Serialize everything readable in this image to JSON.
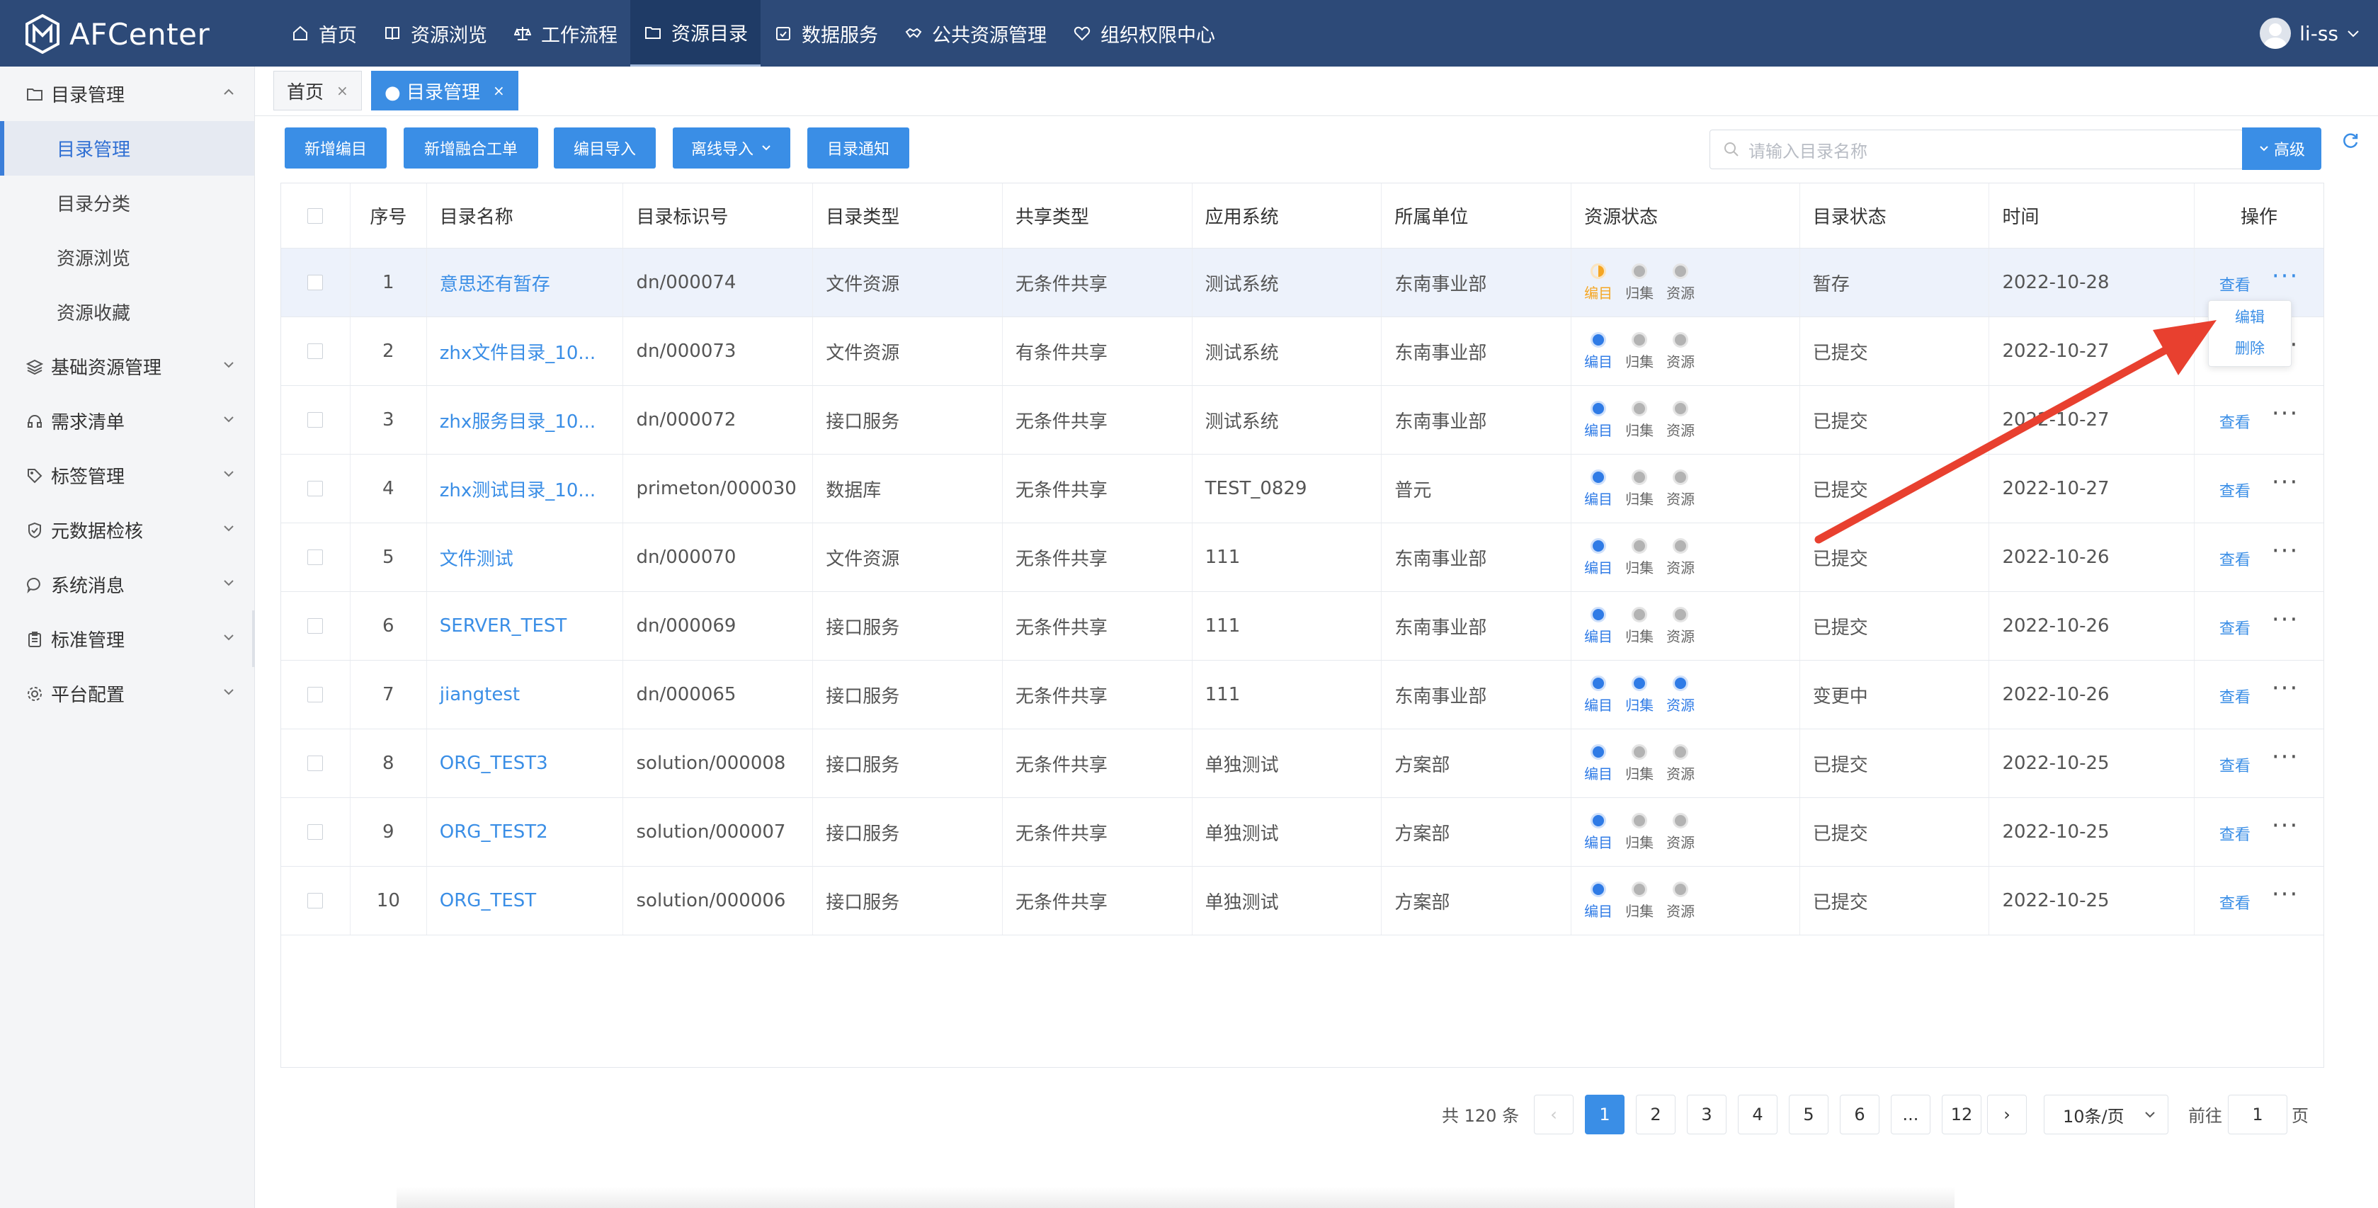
{
  "app": {
    "name": "AFCenter"
  },
  "topnav": [
    {
      "label": "首页",
      "icon": "home-icon",
      "active": false
    },
    {
      "label": "资源浏览",
      "icon": "book-icon",
      "active": false
    },
    {
      "label": "工作流程",
      "icon": "scale-icon",
      "active": false
    },
    {
      "label": "资源目录",
      "icon": "folder-icon",
      "active": true
    },
    {
      "label": "数据服务",
      "icon": "calendar-check-icon",
      "active": false
    },
    {
      "label": "公共资源管理",
      "icon": "handshake-icon",
      "active": false
    },
    {
      "label": "组织权限中心",
      "icon": "heart-shield-icon",
      "active": false
    }
  ],
  "user": {
    "name": "li-ss"
  },
  "sidebar": {
    "groups": [
      {
        "label": "目录管理",
        "icon": "folder-icon",
        "expanded": true,
        "items": [
          {
            "label": "目录管理",
            "active": true
          },
          {
            "label": "目录分类",
            "active": false
          },
          {
            "label": "资源浏览",
            "active": false
          },
          {
            "label": "资源收藏",
            "active": false
          }
        ]
      },
      {
        "label": "基础资源管理",
        "icon": "layers-icon"
      },
      {
        "label": "需求清单",
        "icon": "headset-icon"
      },
      {
        "label": "标签管理",
        "icon": "tag-icon"
      },
      {
        "label": "元数据检核",
        "icon": "shield-check-icon"
      },
      {
        "label": "系统消息",
        "icon": "chat-icon"
      },
      {
        "label": "标准管理",
        "icon": "clipboard-icon"
      },
      {
        "label": "平台配置",
        "icon": "gear-icon"
      }
    ]
  },
  "tabs": [
    {
      "label": "首页",
      "close": "×"
    },
    {
      "label": "● 目录管理",
      "close": "×"
    }
  ],
  "toolbar": {
    "buttons": [
      "新增编目",
      "新增融合工单",
      "编目导入",
      "离线导入",
      "目录通知"
    ],
    "search_placeholder": "请输入目录名称",
    "advanced": "高级"
  },
  "table": {
    "headers": [
      "",
      "序号",
      "目录名称",
      "目录标识号",
      "目录类型",
      "共享类型",
      "应用系统",
      "所属单位",
      "资源状态",
      "目录状态",
      "时间",
      "操作"
    ],
    "status_labels": [
      "编目",
      "归集",
      "资源"
    ],
    "view_label": "查看",
    "more_label": "···",
    "rows": [
      {
        "no": "1",
        "name": "意思还有暂存",
        "id": "dn/000074",
        "type": "文件资源",
        "share": "无条件共享",
        "system": "测试系统",
        "unit": "东南事业部",
        "status": [
          "half",
          "off",
          "off"
        ],
        "dir_status": "暂存",
        "time": "2022-10-28"
      },
      {
        "no": "2",
        "name": "zhx文件目录_10...",
        "id": "dn/000073",
        "type": "文件资源",
        "share": "有条件共享",
        "system": "测试系统",
        "unit": "东南事业部",
        "status": [
          "on",
          "off",
          "off"
        ],
        "dir_status": "已提交",
        "time": "2022-10-27"
      },
      {
        "no": "3",
        "name": "zhx服务目录_10...",
        "id": "dn/000072",
        "type": "接口服务",
        "share": "无条件共享",
        "system": "测试系统",
        "unit": "东南事业部",
        "status": [
          "on",
          "off",
          "off"
        ],
        "dir_status": "已提交",
        "time": "2022-10-27"
      },
      {
        "no": "4",
        "name": "zhx测试目录_10...",
        "id": "primeton/000030",
        "type": "数据库",
        "share": "无条件共享",
        "system": "TEST_0829",
        "unit": "普元",
        "status": [
          "on",
          "off",
          "off"
        ],
        "dir_status": "已提交",
        "time": "2022-10-27"
      },
      {
        "no": "5",
        "name": "文件测试",
        "id": "dn/000070",
        "type": "文件资源",
        "share": "无条件共享",
        "system": "111",
        "unit": "东南事业部",
        "status": [
          "on",
          "off",
          "off"
        ],
        "dir_status": "已提交",
        "time": "2022-10-26"
      },
      {
        "no": "6",
        "name": "SERVER_TEST",
        "id": "dn/000069",
        "type": "接口服务",
        "share": "无条件共享",
        "system": "111",
        "unit": "东南事业部",
        "status": [
          "on",
          "off",
          "off"
        ],
        "dir_status": "已提交",
        "time": "2022-10-26"
      },
      {
        "no": "7",
        "name": "jiangtest",
        "id": "dn/000065",
        "type": "接口服务",
        "share": "无条件共享",
        "system": "111",
        "unit": "东南事业部",
        "status": [
          "on",
          "on",
          "on"
        ],
        "dir_status": "变更中",
        "time": "2022-10-26"
      },
      {
        "no": "8",
        "name": "ORG_TEST3",
        "id": "solution/000008",
        "type": "接口服务",
        "share": "无条件共享",
        "system": "单独测试",
        "unit": "方案部",
        "status": [
          "on",
          "off",
          "off"
        ],
        "dir_status": "已提交",
        "time": "2022-10-25"
      },
      {
        "no": "9",
        "name": "ORG_TEST2",
        "id": "solution/000007",
        "type": "接口服务",
        "share": "无条件共享",
        "system": "单独测试",
        "unit": "方案部",
        "status": [
          "on",
          "off",
          "off"
        ],
        "dir_status": "已提交",
        "time": "2022-10-25"
      },
      {
        "no": "10",
        "name": "ORG_TEST",
        "id": "solution/000006",
        "type": "接口服务",
        "share": "无条件共享",
        "system": "单独测试",
        "unit": "方案部",
        "status": [
          "on",
          "off",
          "off"
        ],
        "dir_status": "已提交",
        "time": "2022-10-25"
      }
    ]
  },
  "row_menu": {
    "items": [
      "编辑",
      "删除"
    ]
  },
  "pagination": {
    "total": "共 120 条",
    "pages": [
      "1",
      "2",
      "3",
      "4",
      "5",
      "6",
      "...",
      "12"
    ],
    "current": "1",
    "prev": "‹",
    "next": "›",
    "page_size": "10条/页",
    "goto_label": "前往",
    "goto_value": "1",
    "goto_suffix": "页"
  },
  "colors": {
    "topbar": "#2d4a78",
    "accent": "#3a8ee6",
    "arrow": "#e8402f",
    "pending": "#f5a623"
  }
}
